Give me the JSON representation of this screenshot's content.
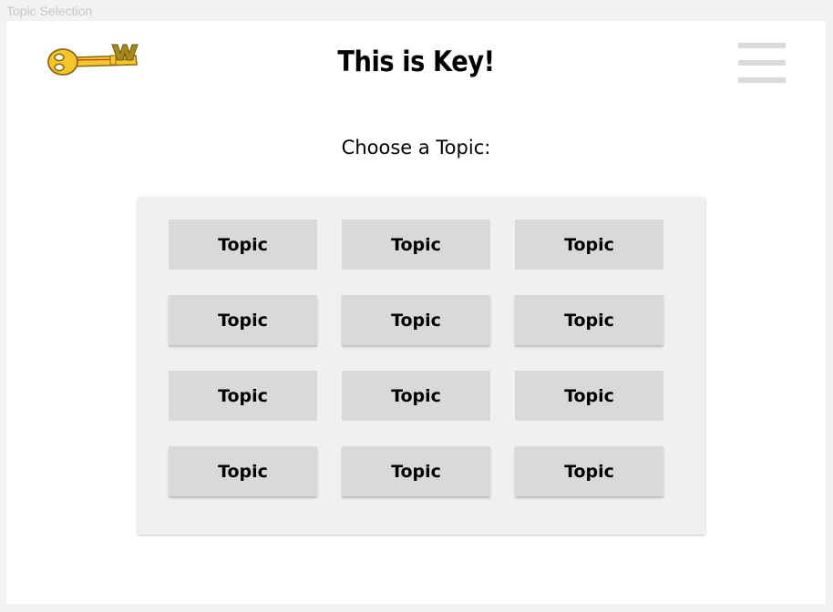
{
  "window": {
    "label": "Topic Selection"
  },
  "header": {
    "logo_icon": "key-logo-icon",
    "logo_letter": "W",
    "title": "This is Key!",
    "menu_icon": "hamburger-menu-icon"
  },
  "main": {
    "prompt": "Choose a Topic:",
    "topics": [
      "Topic",
      "Topic",
      "Topic",
      "Topic",
      "Topic",
      "Topic",
      "Topic",
      "Topic",
      "Topic",
      "Topic",
      "Topic",
      "Topic"
    ]
  },
  "colors": {
    "background": "#f2f2f2",
    "card": "#ffffff",
    "panel": "#f0f0f0",
    "button": "#d9d9d9",
    "menu_bars": "#d9d9d9",
    "key_gold": "#f5c52a",
    "key_outline": "#8a6a10",
    "logo_letter": "#a8891c"
  }
}
